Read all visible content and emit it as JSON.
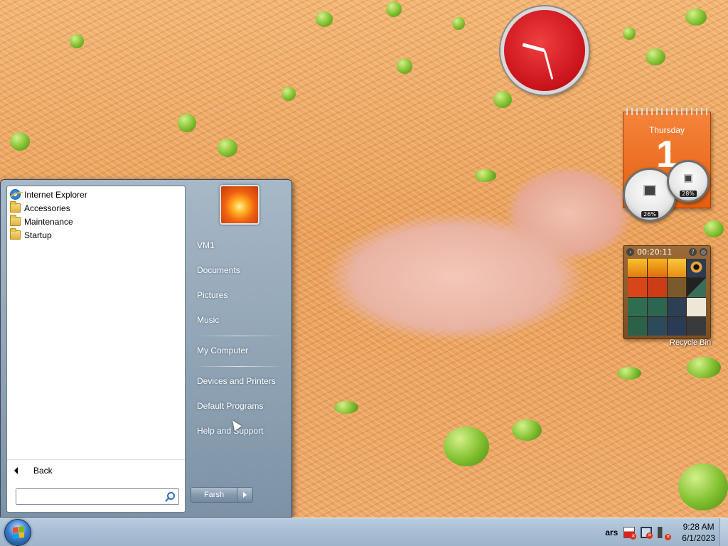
{
  "start_menu": {
    "programs": [
      {
        "label": "Internet Explorer",
        "icon": "internet-explorer-icon"
      },
      {
        "label": "Accessories",
        "icon": "folder-icon"
      },
      {
        "label": "Maintenance",
        "icon": "folder-icon"
      },
      {
        "label": "Startup",
        "icon": "folder-icon"
      }
    ],
    "back_label": "Back",
    "search": {
      "value": "",
      "placeholder": ""
    },
    "right_links": {
      "user": "VM1",
      "documents": "Documents",
      "pictures": "Pictures",
      "music": "Music",
      "computer": "My Computer",
      "devices": "Devices and Printers",
      "default_programs": "Default Programs",
      "help": "Help and Support"
    },
    "shutdown_label": "Farsh"
  },
  "gadgets": {
    "calendar": {
      "day_name": "Thursday",
      "day_number": "1"
    },
    "cpu_meter": {
      "cpu": "26%",
      "memory": "28%"
    },
    "puzzle": {
      "timer": "00:20:11"
    }
  },
  "desktop": {
    "recycle_bin_label": "Recycle Bin"
  },
  "taskbar": {
    "language": "ars",
    "time": "9:28 AM",
    "date": "6/1/2023"
  },
  "colors": {
    "taskbar": "#a9bfd6",
    "start_menu": "#8ea4b9",
    "calendar": "#e86a1c",
    "clock": "#c9121b"
  }
}
